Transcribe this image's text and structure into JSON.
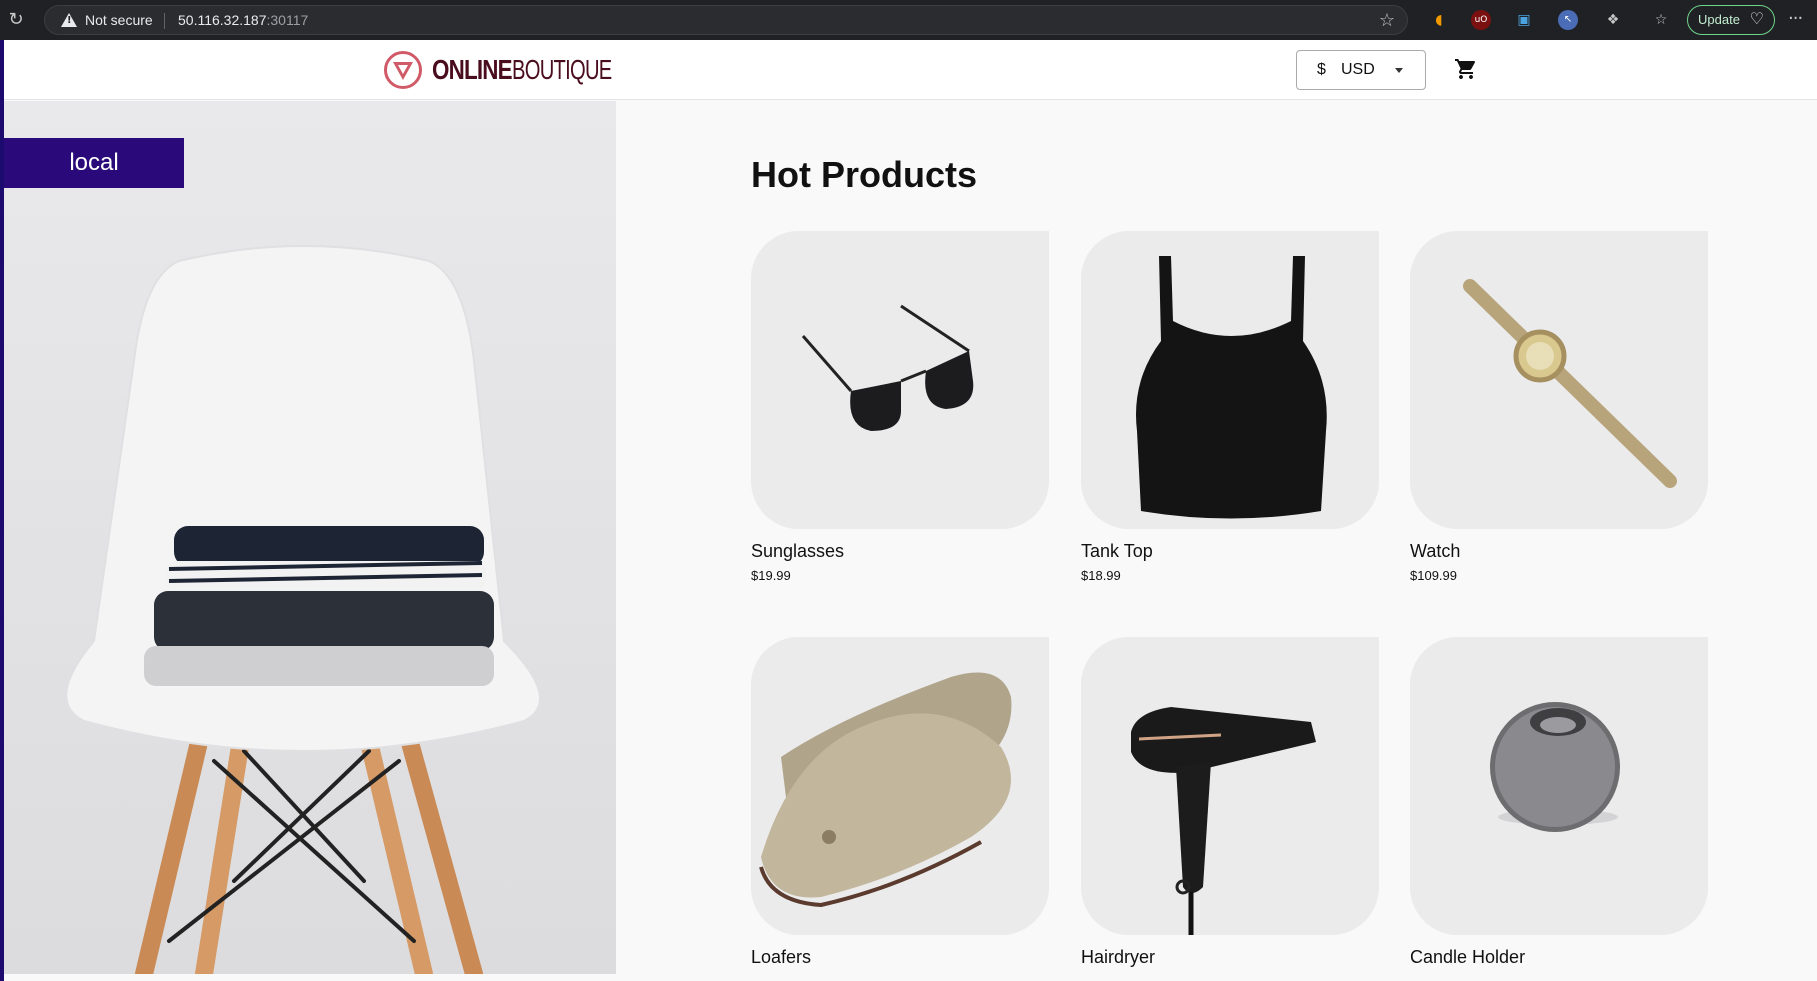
{
  "browser": {
    "security_label": "Not secure",
    "url_host": "50.116.32.187",
    "url_port": ":30117",
    "update_label": "Update"
  },
  "header": {
    "logo_online": "ONLINE",
    "logo_boutique": "BOUTIQUE",
    "currency_symbol": "$",
    "currency_code": "USD"
  },
  "hero": {
    "badge": "local"
  },
  "main": {
    "title": "Hot Products",
    "products": [
      {
        "name": "Sunglasses",
        "price": "$19.99",
        "icon": "sunglasses"
      },
      {
        "name": "Tank Top",
        "price": "$18.99",
        "icon": "tank-top"
      },
      {
        "name": "Watch",
        "price": "$109.99",
        "icon": "watch"
      },
      {
        "name": "Loafers",
        "price": "",
        "icon": "loafers"
      },
      {
        "name": "Hairdryer",
        "price": "",
        "icon": "hairdryer"
      },
      {
        "name": "Candle Holder",
        "price": "",
        "icon": "candle-holder"
      }
    ]
  },
  "colors": {
    "badge_bg": "#2a0a7a",
    "logo": "#4a0d1e",
    "logo_mark": "#d15a68",
    "browser_bg": "#202124"
  }
}
